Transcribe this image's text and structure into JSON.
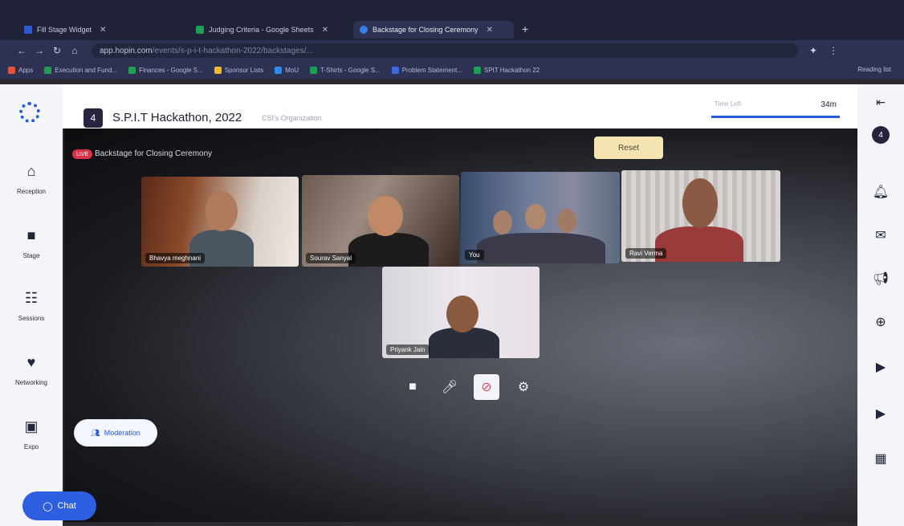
{
  "browser": {
    "tabs": [
      {
        "label": "Fill Stage Widget",
        "color": "#2a5bd7"
      },
      {
        "label": "Judging Criteria - Google Sheets",
        "color": "#1e9e56"
      },
      {
        "label": "Backstage for Closing Ceremony",
        "color": "#3d7be6"
      }
    ],
    "url_host": "app.hopin.com",
    "url_path": "/events/s-p-i-t-hackathon-2022/backstages/...",
    "bookmarks": [
      "Apps",
      "Execution and Fund...",
      "Finances - Google S...",
      "Sponsor Lists",
      "MoU",
      "T-Shirts - Google S...",
      "Problem Statement...",
      "SPIT Hackathon 22"
    ],
    "reading_list": "Reading list"
  },
  "rail": {
    "items": [
      {
        "label": "Reception",
        "icon": "home-icon"
      },
      {
        "label": "Stage",
        "icon": "stage-icon"
      },
      {
        "label": "Sessions",
        "icon": "sessions-icon"
      },
      {
        "label": "Networking",
        "icon": "networking-icon"
      },
      {
        "label": "Expo",
        "icon": "expo-icon"
      }
    ]
  },
  "header": {
    "logo_letter": "4",
    "event_title": "S.P.I.T Hackathon, 2022",
    "organization": "CSI's Organization",
    "time_left_label": "Time Left",
    "time_left_value": "34m"
  },
  "stage": {
    "live_badge": "LIVE",
    "title": "Backstage for Closing Ceremony",
    "reset_label": "Reset",
    "participants": [
      "Bhavya meghnani",
      "Sourav Sanyal",
      "You",
      "Ravi Verma",
      "Priyank Jain"
    ],
    "moderation_label": "Moderation"
  },
  "chat": {
    "label": "Chat"
  },
  "colors": {
    "accent": "#2d5fe0",
    "live": "#d8334a",
    "reset_bg": "#f3e4b0"
  }
}
